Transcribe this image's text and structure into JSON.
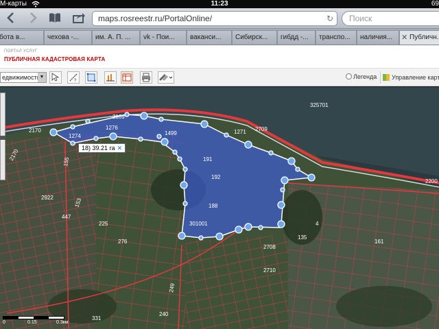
{
  "statusbar": {
    "carrier": "M-карты",
    "time": "11:23",
    "battery": "69"
  },
  "browser": {
    "url": "maps.rosreestr.ru/PortalOnline/",
    "search_placeholder": "Поиск",
    "tabs": [
      {
        "label": "бота в...",
        "close": ""
      },
      {
        "label": "чехова -...",
        "close": ""
      },
      {
        "label": "им. А. П. ...",
        "close": ""
      },
      {
        "label": "vk - Пои...",
        "close": ""
      },
      {
        "label": "ваканси...",
        "close": ""
      },
      {
        "label": "Сибирск...",
        "close": ""
      },
      {
        "label": "гибдд -...",
        "close": ""
      },
      {
        "label": "транспо...",
        "close": ""
      },
      {
        "label": "наличия...",
        "close": ""
      },
      {
        "label": "Публичн...",
        "close": "✕"
      }
    ]
  },
  "portal": {
    "small_label": "ПОРТАЛ УСЛУГ",
    "title": "ПУБЛИЧНАЯ КАДАСТРОВАЯ КАРТА"
  },
  "map_toolbar": {
    "select_value": "едвижимость",
    "legend_label": "Легенда",
    "manage_label": "Управление картой"
  },
  "map": {
    "area_tooltip": "18) 39.21 га",
    "area_tooltip_close": "✕",
    "colors": {
      "parcel_line": "#e0393e",
      "selection_fill": "#3d5fe0",
      "selection_edge": "#ffffff",
      "vertex": "#6fa8f0"
    },
    "labels": {
      "quarter_top": "325701",
      "selected_number": "301001",
      "sel_a": "1274",
      "sel_b": "1276",
      "sel_c": "2169",
      "sel_d": "2170",
      "sel_e": "1271",
      "sel_f": "1499",
      "sel_g": "191",
      "sel_h": "192",
      "sel_i": "188",
      "left_a": "2170",
      "left_b": "2922",
      "left_c": "447",
      "left_d": "225",
      "left_e": "276",
      "left_f": "155",
      "left_g": "153",
      "right_a": "2709",
      "right_b": "2710",
      "right_c": "2708",
      "right_d": "161",
      "right_e": "2200",
      "right_f": "4",
      "bottom_a": "240",
      "bottom_b": "249",
      "bottom_c": "331",
      "bottom_d": "135"
    },
    "scale": {
      "zero": "0",
      "mid": "0.15",
      "end": "0.3км"
    }
  }
}
